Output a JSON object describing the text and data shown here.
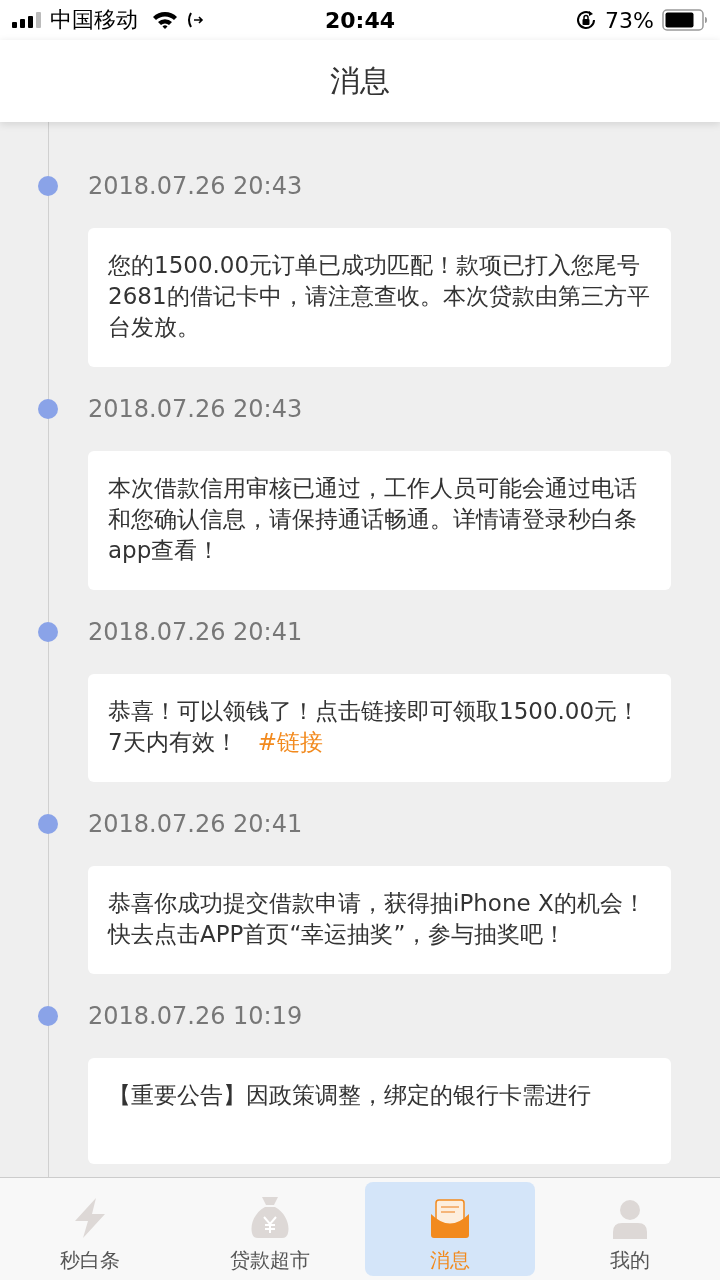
{
  "status_bar": {
    "carrier": "中国移动",
    "time": "20:44",
    "battery": "73%"
  },
  "header": {
    "title": "消息"
  },
  "messages": [
    {
      "time": "2018.07.26 20:43",
      "text": "您的1500.00元订单已成功匹配！款项已打入您尾号2681的借记卡中，请注意查收。本次贷款由第三方平台发放。"
    },
    {
      "time": "2018.07.26 20:43",
      "text": "本次借款信用审核已通过，工作人员可能会通过电话和您确认信息，请保持通话畅通。详情请登录秒白条app查看！"
    },
    {
      "time": "2018.07.26 20:41",
      "text": "恭喜！可以领钱了！点击链接即可领取1500.00元！7天内有效！",
      "link": "#链接"
    },
    {
      "time": "2018.07.26 20:41",
      "text": "恭喜你成功提交借款申请，获得抽iPhone X的机会！快去点击APP首页“幸运抽奖”，参与抽奖吧！"
    },
    {
      "time": "2018.07.26 10:19",
      "text": "【重要公告】因政策调整，绑定的银行卡需进行"
    }
  ],
  "tabs": [
    {
      "label": "秒白条",
      "kind": "bolt",
      "selected": false
    },
    {
      "label": "贷款超市",
      "kind": "bag",
      "selected": false
    },
    {
      "label": "消息",
      "kind": "mail",
      "selected": true
    },
    {
      "label": "我的",
      "kind": "person",
      "selected": false
    }
  ]
}
